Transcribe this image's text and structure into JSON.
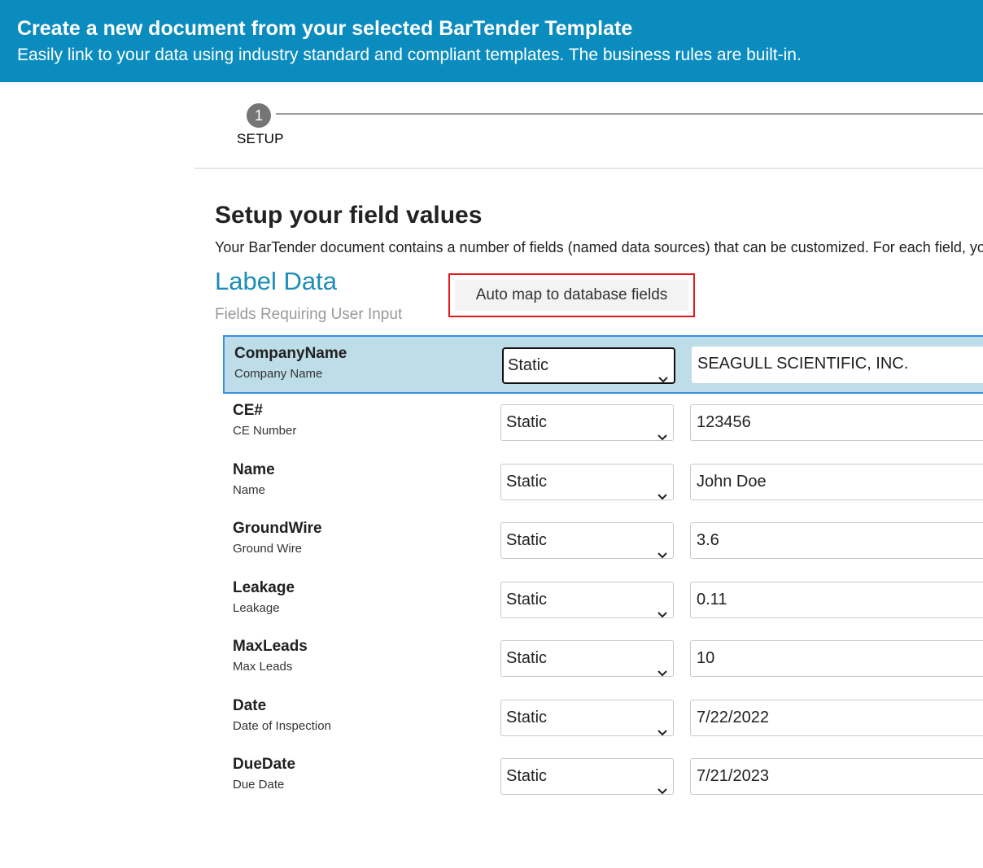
{
  "banner": {
    "title": "Create a new document from your selected BarTender Template",
    "subtitle": "Easily link to your data using industry standard and compliant templates. The business rules are built-in."
  },
  "stepper": {
    "step_number": "1",
    "step_label": "SETUP"
  },
  "page": {
    "title": "Setup your field values",
    "description": "Your BarTender document contains a number of fields (named data sources) that can be customized. For each field, you ca"
  },
  "section": {
    "title": "Label Data",
    "subtitle": "Fields Requiring User Input",
    "automap_label": "Auto map to database fields"
  },
  "fields": [
    {
      "name": "CompanyName",
      "description": "Company Name",
      "source": "Static",
      "value": "SEAGULL SCIENTIFIC, INC.",
      "selected": true
    },
    {
      "name": "CE#",
      "description": "CE Number",
      "source": "Static",
      "value": "123456",
      "selected": false
    },
    {
      "name": "Name",
      "description": "Name",
      "source": "Static",
      "value": "John Doe",
      "selected": false
    },
    {
      "name": "GroundWire",
      "description": "Ground Wire",
      "source": "Static",
      "value": "3.6",
      "selected": false
    },
    {
      "name": "Leakage",
      "description": "Leakage",
      "source": "Static",
      "value": "0.11",
      "selected": false
    },
    {
      "name": "MaxLeads",
      "description": "Max Leads",
      "source": "Static",
      "value": "10",
      "selected": false
    },
    {
      "name": "Date",
      "description": "Date of Inspection",
      "source": "Static",
      "value": "7/22/2022",
      "selected": false
    },
    {
      "name": "DueDate",
      "description": "Due Date",
      "source": "Static",
      "value": "7/21/2023",
      "selected": false
    }
  ],
  "colors": {
    "banner": "#0b8cbf",
    "accent": "#1b8db8",
    "highlight_row": "#bddde8",
    "highlight_border": "#3b8ee0",
    "callout_border": "#e5161c"
  },
  "icons": {
    "dropdown": "chevron-down-icon"
  }
}
